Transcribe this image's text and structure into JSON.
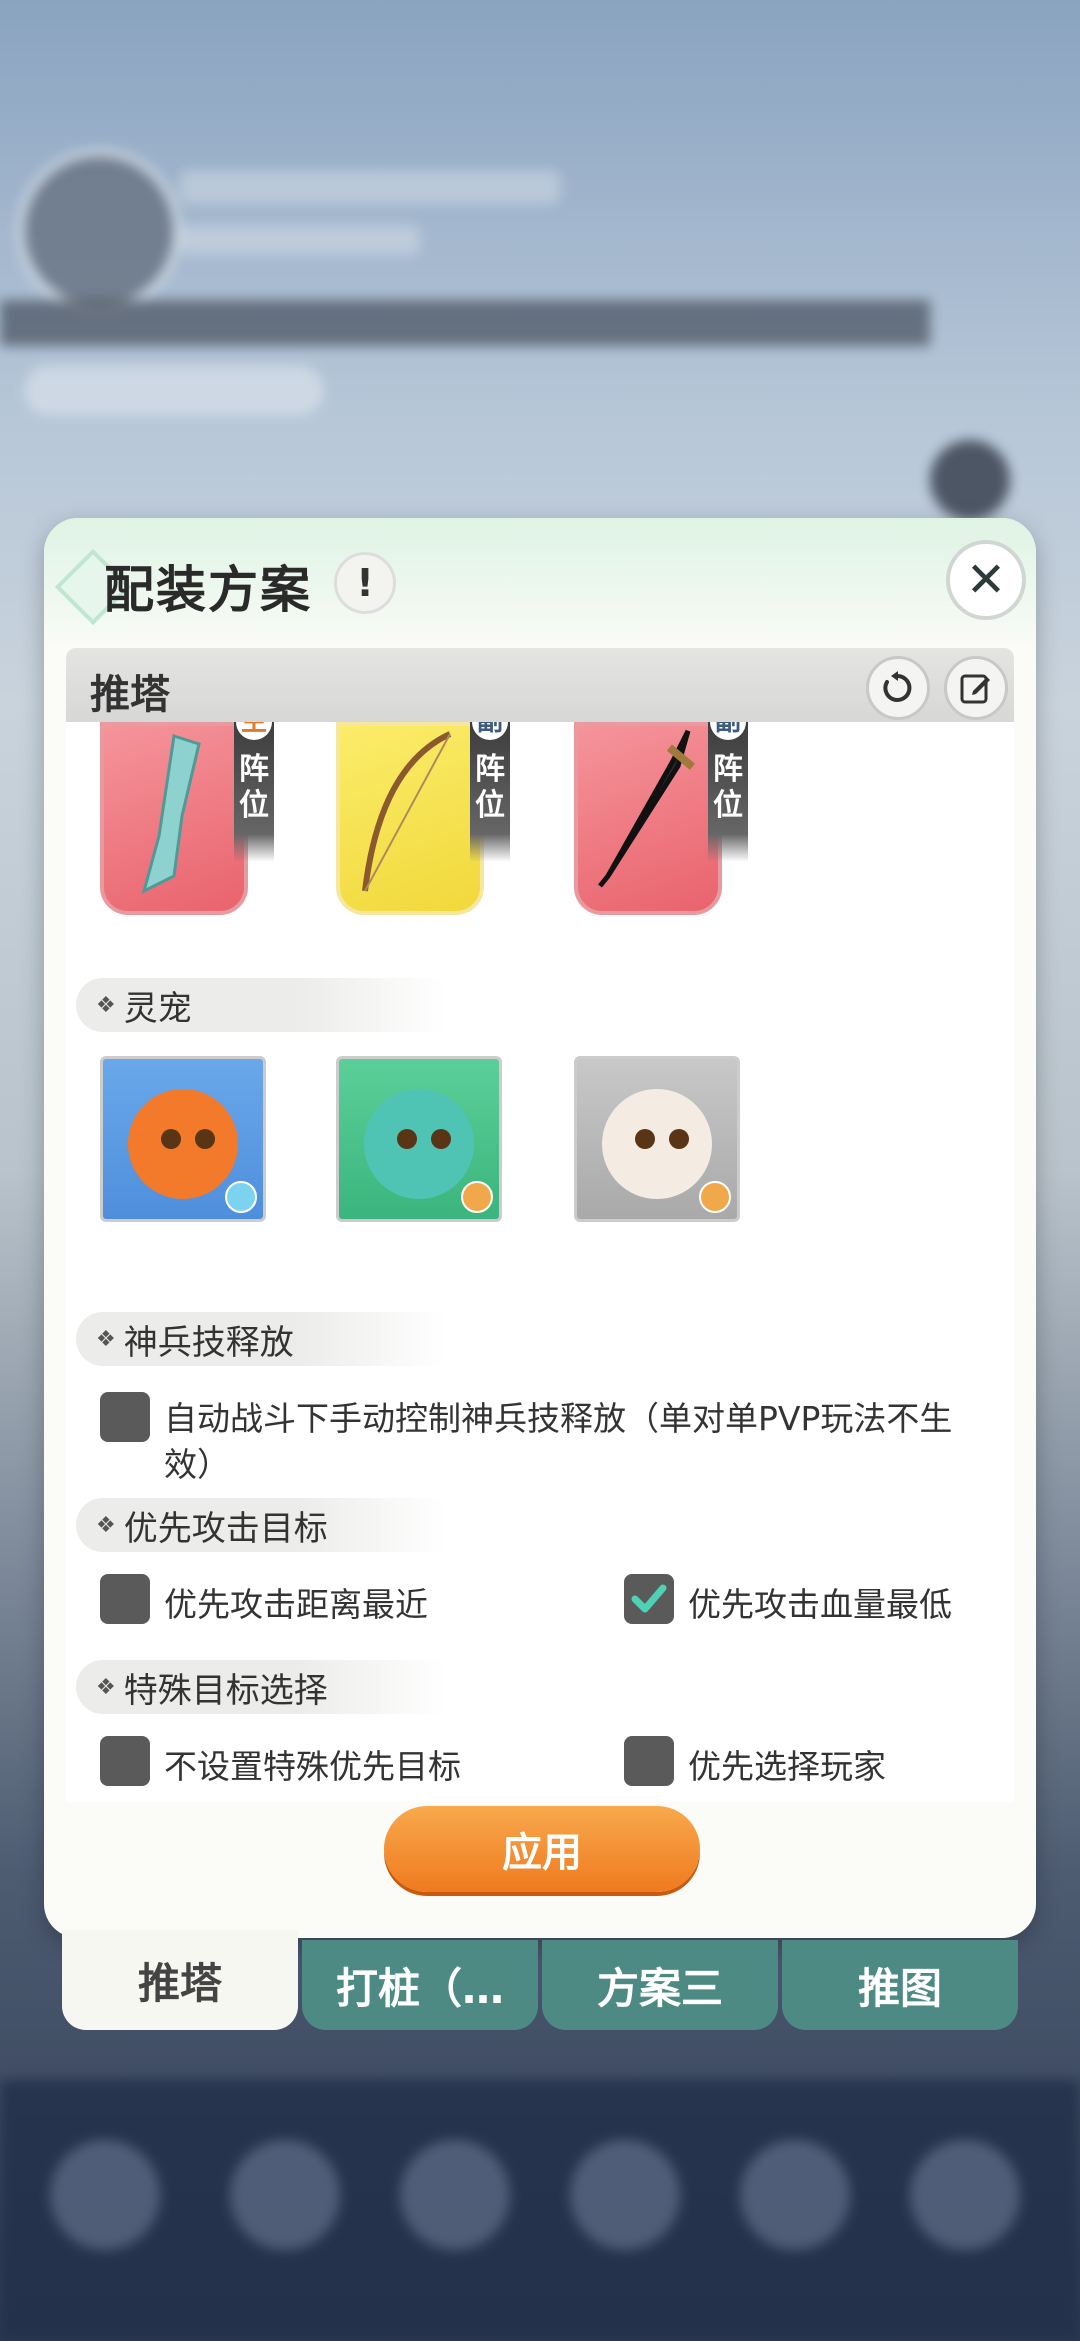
{
  "panel": {
    "title": "配装方案",
    "info_icon": "!",
    "close_icon": "✕",
    "subheader_label": "推塔"
  },
  "weapons": [
    {
      "tag_top": "主",
      "tag": "阵位",
      "color": "#e9636d"
    },
    {
      "tag_top": "副",
      "tag": "阵位",
      "color": "#f1d93b"
    },
    {
      "tag_top": "副",
      "tag": "阵位",
      "color": "#e9636d"
    }
  ],
  "sections": {
    "pets": "灵宠",
    "skill": "神兵技释放",
    "priority": "优先攻击目标",
    "special": "特殊目标选择"
  },
  "options": {
    "manual_skill": "自动战斗下手动控制神兵技释放（单对单PVP玩法不生效）",
    "nearest": "优先攻击距离最近",
    "lowest_hp": "优先攻击血量最低",
    "no_special": "不设置特殊优先目标",
    "prefer_player": "优先选择玩家"
  },
  "apply_label": "应用",
  "tabs": [
    "推塔",
    "打桩（…",
    "方案三",
    "推图"
  ],
  "colors": {
    "accent": "#ef7a1f",
    "tab_inactive": "#4d8a83",
    "check_mark": "#4fd1b5"
  }
}
